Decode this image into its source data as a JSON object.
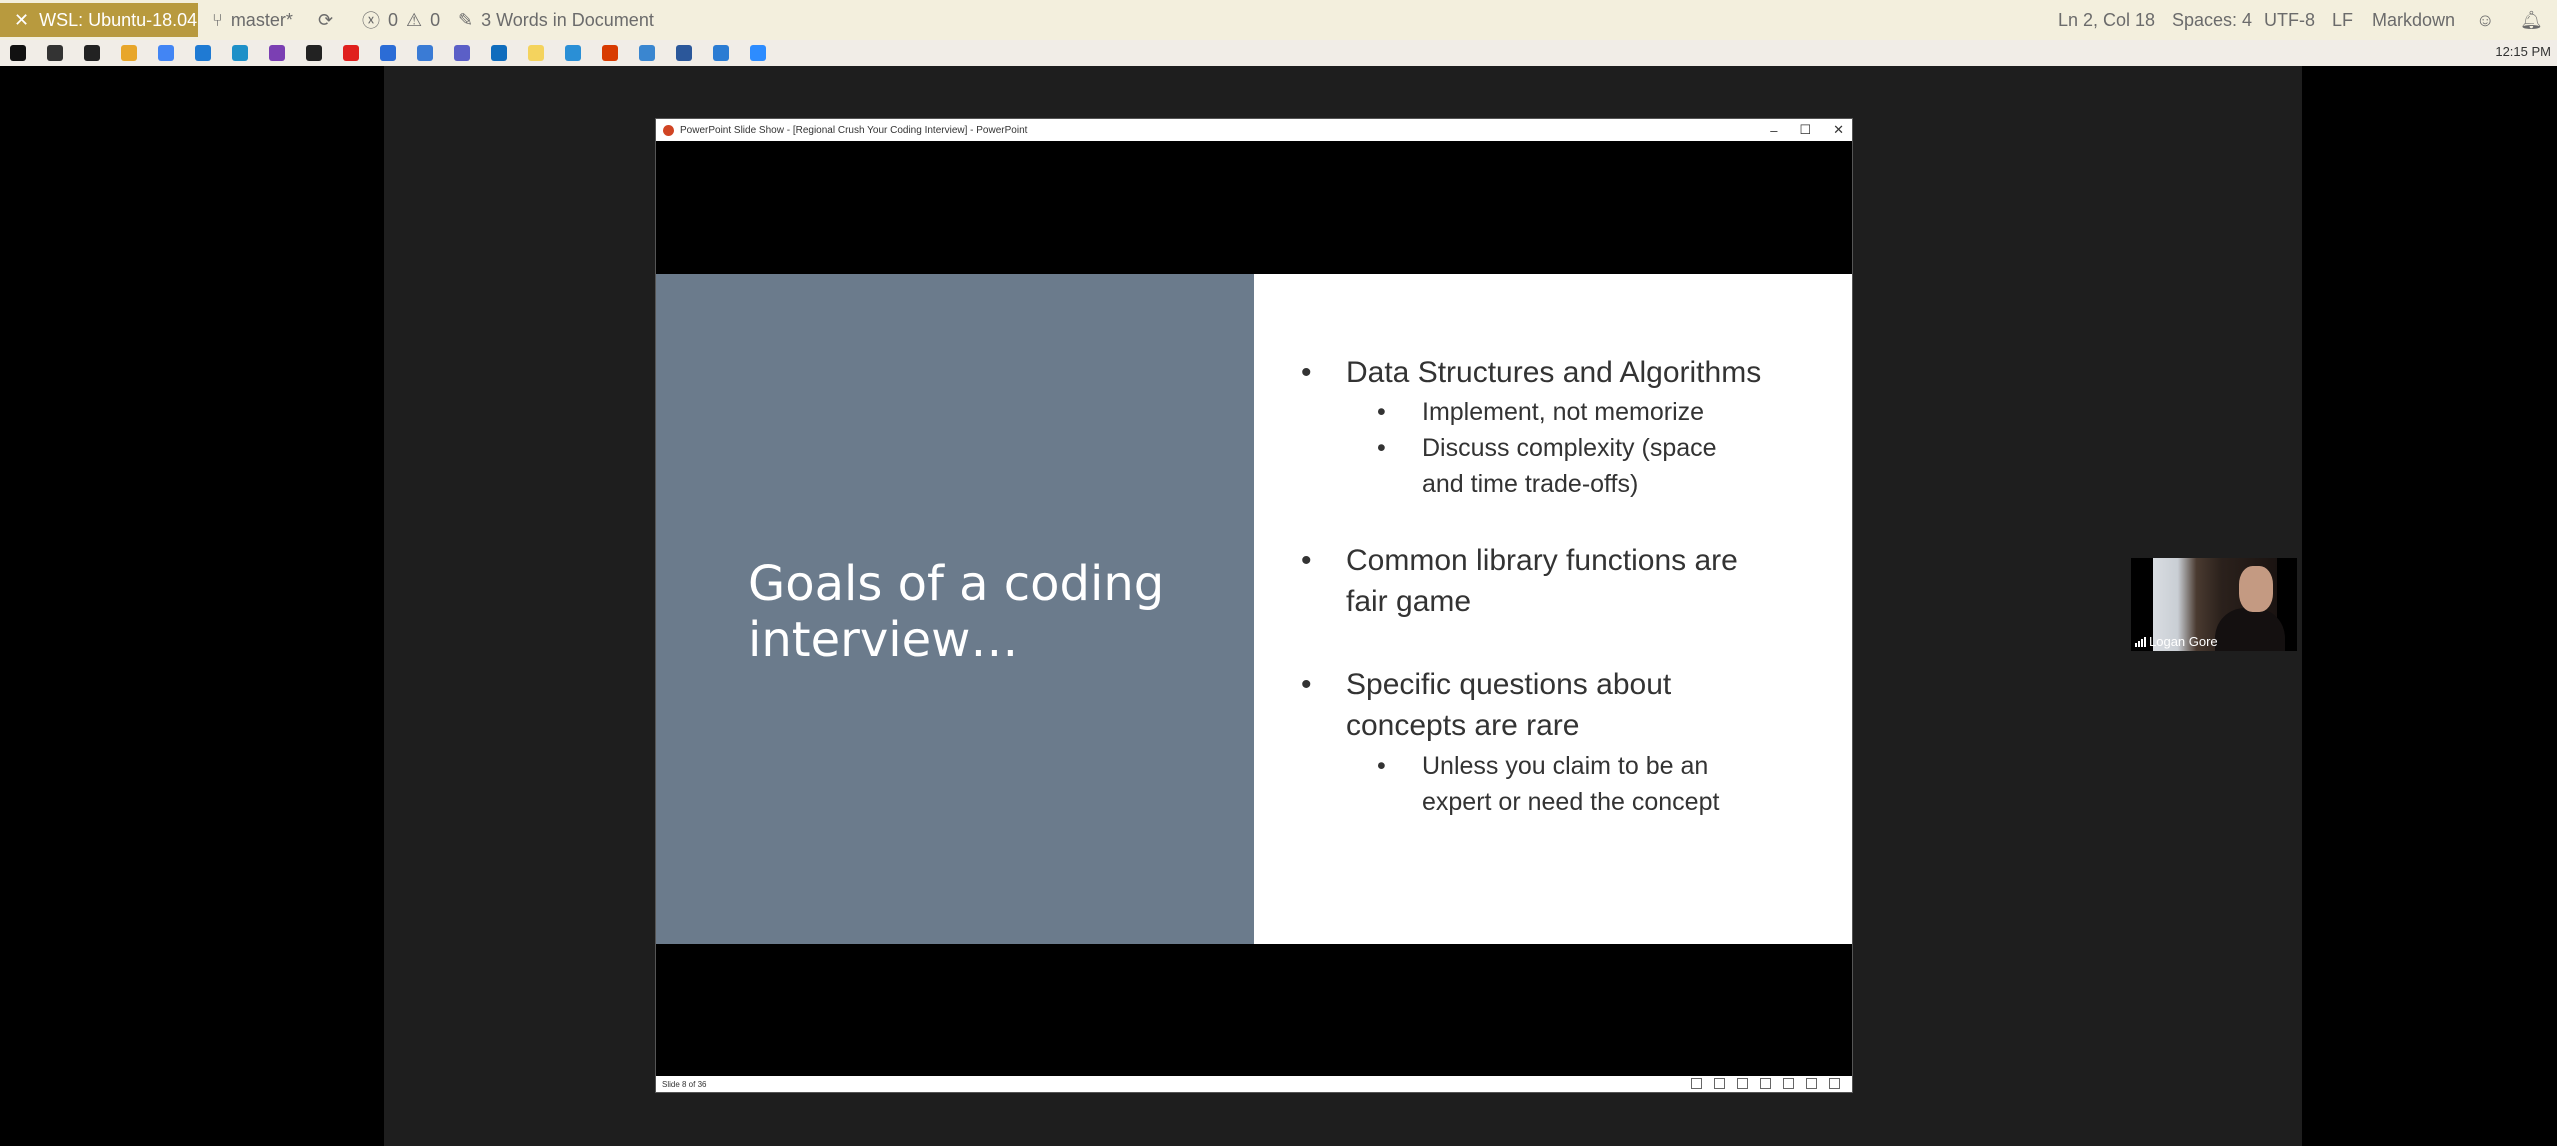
{
  "statusbar": {
    "remote": "WSL: Ubuntu-18.04",
    "branch": "master*",
    "errors": "0",
    "warnings": "0",
    "words": "3 Words in Document",
    "position": "Ln 2, Col 18",
    "spaces": "Spaces: 4",
    "encoding": "UTF-8",
    "eol": "LF",
    "language": "Markdown"
  },
  "taskbar": {
    "clock": "12:15 PM",
    "icons": [
      "windows-start-icon",
      "task-view-icon",
      "terminal-icon",
      "file-explorer-icon",
      "chrome-icon",
      "vscode-icon",
      "edge-icon",
      "visual-studio-icon",
      "cmd-icon",
      "opera-icon",
      "snip-icon",
      "app-icon",
      "teams-icon",
      "outlook-icon",
      "sticky-icon",
      "cortana-icon",
      "office-icon",
      "remote-desktop-icon",
      "word-icon",
      "calendar-icon",
      "zoom-icon"
    ],
    "colors": [
      "#111111",
      "#333333",
      "#222222",
      "#e8a62a",
      "#4285f4",
      "#1f7ad3",
      "#1e90c8",
      "#7b3fb3",
      "#222222",
      "#e0201d",
      "#2b6cd6",
      "#3a7bd5",
      "#5b5fc7",
      "#0f6cbd",
      "#f4d35e",
      "#2a8fd6",
      "#d83b01",
      "#3a86d0",
      "#2b579a",
      "#2b7cd3",
      "#2d8cff"
    ]
  },
  "ppt": {
    "window_title": "PowerPoint Slide Show - [Regional Crush Your Coding Interview] - PowerPoint",
    "slide_title": "Goals of a coding interview…",
    "bullet_char": "•",
    "bullets": [
      {
        "text": "Data Structures and Algorithms",
        "subs": [
          "Implement, not memorize",
          "Discuss complexity (space and time trade-offs)"
        ]
      },
      {
        "text": "Common library functions are fair game",
        "subs": []
      },
      {
        "text": "Specific questions about concepts are rare",
        "subs": [
          "Unless you claim to be an expert or need the concept"
        ]
      }
    ],
    "status": "Slide 8 of 36"
  },
  "webcam": {
    "name": "Logan Gore"
  }
}
